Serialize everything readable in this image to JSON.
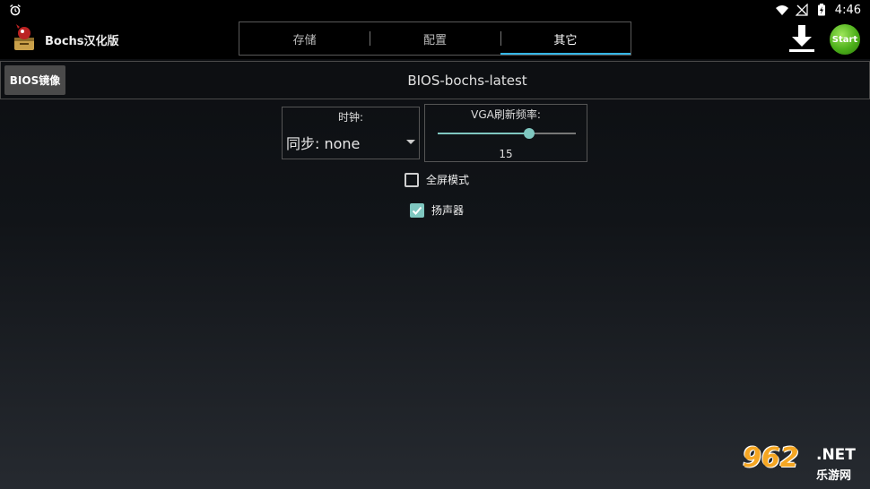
{
  "status_bar": {
    "time": "4:46",
    "icons": [
      "alarm-icon",
      "wifi-icon",
      "no-signal-icon",
      "battery-charging-icon"
    ]
  },
  "app": {
    "title": "Bochs汉化版",
    "logo_icon": "bochs-logo-icon"
  },
  "tabs": [
    {
      "label": "存储",
      "active": false
    },
    {
      "label": "配置",
      "active": false
    },
    {
      "label": "其它",
      "active": true
    }
  ],
  "actions": {
    "download_icon": "download-icon",
    "start_label": "Start"
  },
  "bios": {
    "button_label": "BIOS镜像",
    "value": "BIOS-bochs-latest"
  },
  "clock": {
    "label": "时钟:",
    "selected": "同步:  none"
  },
  "vga": {
    "label": "VGA刷新频率:",
    "value": "15",
    "slider_fraction": 0.66
  },
  "options": {
    "fullscreen": {
      "label": "全屏模式",
      "checked": false
    },
    "speaker": {
      "label": "扬声器",
      "checked": true
    }
  },
  "watermark": {
    "logo": "962",
    "net": ".NET",
    "sub": "乐游网"
  },
  "colors": {
    "accent": "#33b5e5",
    "slider": "#7fc7c0",
    "start_button": "#4caf1a",
    "watermark_orange": "#f5a623"
  }
}
